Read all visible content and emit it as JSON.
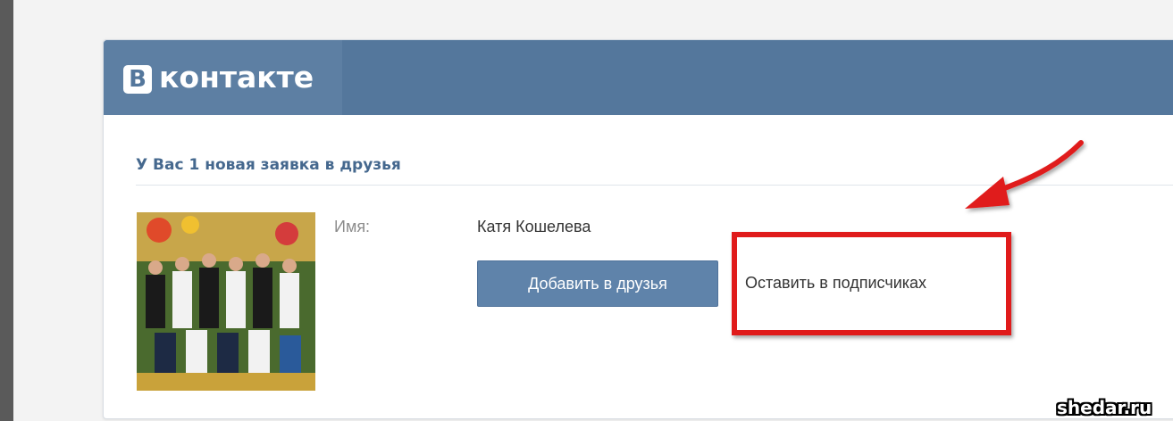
{
  "header": {
    "logo_letter": "В",
    "logo_text": "контакте"
  },
  "email": {
    "subject": "У Вас 1 новая заявка в друзья",
    "name_label": "Имя:",
    "name_value": "Катя Кошелева",
    "add_button_label": "Добавить в друзья",
    "keep_link_label": "Оставить в подписчиках"
  },
  "watermark": "shedar.ru",
  "icons": {
    "avatar": "avatar-photo",
    "arrow": "red-arrow-icon"
  },
  "colors": {
    "brand_blue": "#54779c",
    "button_blue": "#5f83aa",
    "subject_blue": "#45688e",
    "annotation_red": "#e01b1b"
  }
}
